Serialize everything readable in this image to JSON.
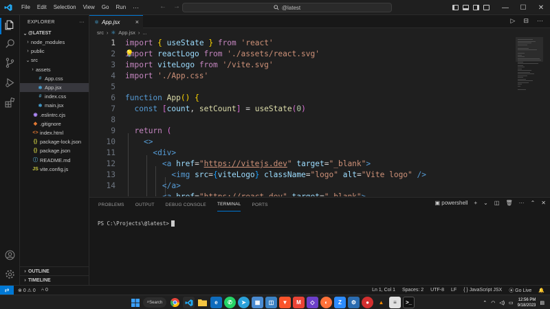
{
  "menu": [
    "File",
    "Edit",
    "Selection",
    "View",
    "Go",
    "Run"
  ],
  "menu_more": "···",
  "nav": {
    "back": "←",
    "forward": "→"
  },
  "command_center": "@latest",
  "window_controls": {
    "minimize": "—",
    "maximize": "☐",
    "close": "✕"
  },
  "explorer": {
    "title": "EXPLORER",
    "more": "···",
    "root": "@LATEST",
    "items": [
      {
        "label": "node_modules",
        "chev": "›",
        "icon": "",
        "indent": 1,
        "type": "folder"
      },
      {
        "label": "public",
        "chev": "›",
        "icon": "",
        "indent": 1,
        "type": "folder"
      },
      {
        "label": "src",
        "chev": "⌄",
        "icon": "",
        "indent": 1,
        "type": "folder"
      },
      {
        "label": "assets",
        "chev": "›",
        "icon": "",
        "indent": 2,
        "type": "folder"
      },
      {
        "label": "App.css",
        "chev": "",
        "icon": "#",
        "indent": 2,
        "type": "css"
      },
      {
        "label": "App.jsx",
        "chev": "",
        "icon": "⚛",
        "indent": 2,
        "type": "jsx",
        "selected": true
      },
      {
        "label": "index.css",
        "chev": "",
        "icon": "#",
        "indent": 2,
        "type": "css"
      },
      {
        "label": "main.jsx",
        "chev": "",
        "icon": "⚛",
        "indent": 2,
        "type": "jsx"
      },
      {
        "label": ".eslintrc.cjs",
        "chev": "",
        "icon": "◉",
        "indent": 1,
        "type": "eslint"
      },
      {
        "label": ".gitignore",
        "chev": "",
        "icon": "◆",
        "indent": 1,
        "type": "git"
      },
      {
        "label": "index.html",
        "chev": "",
        "icon": "<>",
        "indent": 1,
        "type": "html"
      },
      {
        "label": "package-lock.json",
        "chev": "",
        "icon": "{}",
        "indent": 1,
        "type": "json"
      },
      {
        "label": "package.json",
        "chev": "",
        "icon": "{}",
        "indent": 1,
        "type": "json"
      },
      {
        "label": "README.md",
        "chev": "",
        "icon": "ⓘ",
        "indent": 1,
        "type": "md"
      },
      {
        "label": "vite.config.js",
        "chev": "",
        "icon": "JS",
        "indent": 1,
        "type": "js"
      }
    ],
    "outline": "OUTLINE",
    "timeline": "TIMELINE"
  },
  "tab": {
    "label": "App.jsx",
    "icon": "⚛",
    "close": "×"
  },
  "editor_actions": [
    "▷",
    "⊟",
    "···"
  ],
  "breadcrumb": [
    "src",
    "›",
    "⚛",
    "App.jsx",
    "›",
    "..."
  ],
  "code": {
    "line_numbers": [
      "1",
      "2",
      "3",
      "4",
      "5",
      "6",
      "7",
      "8",
      "9",
      "10",
      "11",
      "12",
      "13",
      "14"
    ],
    "active_line": "1"
  },
  "panel": {
    "tabs": [
      "PROBLEMS",
      "OUTPUT",
      "DEBUG CONSOLE",
      "TERMINAL",
      "PORTS"
    ],
    "active": "TERMINAL",
    "shell": "powershell",
    "actions": [
      "+",
      "⌄",
      "◫",
      "🗑",
      "···",
      "⌃",
      "✕"
    ],
    "prompt": "PS C:\\Projects\\@latest>"
  },
  "status": {
    "remote": "⇄",
    "errors": "0",
    "warnings": "0",
    "ports": "0",
    "position": "Ln 1, Col 1",
    "spaces": "Spaces: 2",
    "encoding": "UTF-8",
    "eol": "LF",
    "language": "JavaScript JSX",
    "golive": "Go Live",
    "bell": "🔔"
  },
  "taskbar": {
    "search": "Search",
    "time": "12:56 PM",
    "date": "9/18/2023",
    "tray_chevron": "⌃"
  },
  "colors": {
    "accent": "#0078d4",
    "editor_bg": "#1f1f1f",
    "sidebar_bg": "#181818"
  }
}
